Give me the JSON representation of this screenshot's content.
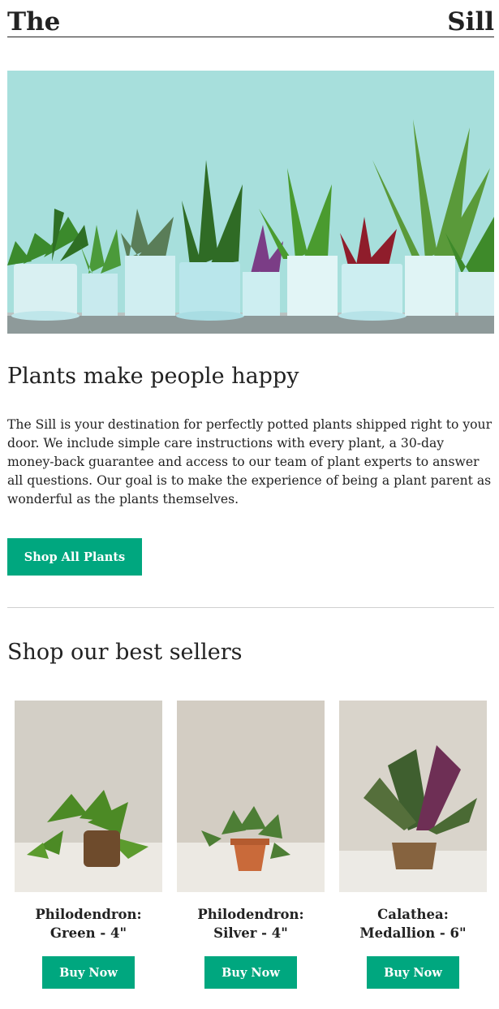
{
  "header": {
    "logo_left": "The",
    "logo_right": "Sill"
  },
  "hero": {
    "image": "plants-row-on-ledge"
  },
  "intro": {
    "title": "Plants make people happy",
    "body": "The Sill is your destination for perfectly potted plants shipped right to your door. We include simple care instructions with every plant, a 30-day money-back guarantee and access to our team of plant experts to answer all questions. Our goal is to make the experience of being a plant parent as wonderful as the plants themselves.",
    "cta_label": "Shop All Plants"
  },
  "best_sellers": {
    "title": "Shop our best sellers",
    "products": [
      {
        "name_line1": "Philodendron:",
        "name_line2": "Green - 4\"",
        "button": "Buy Now"
      },
      {
        "name_line1": "Philodendron:",
        "name_line2": "Silver - 4\"",
        "button": "Buy Now"
      },
      {
        "name_line1": "Calathea:",
        "name_line2": "Medallion - 6\"",
        "button": "Buy Now"
      }
    ]
  },
  "colors": {
    "accent": "#00a77f",
    "hero_bg": "#a7dfdc",
    "text": "#222222"
  }
}
